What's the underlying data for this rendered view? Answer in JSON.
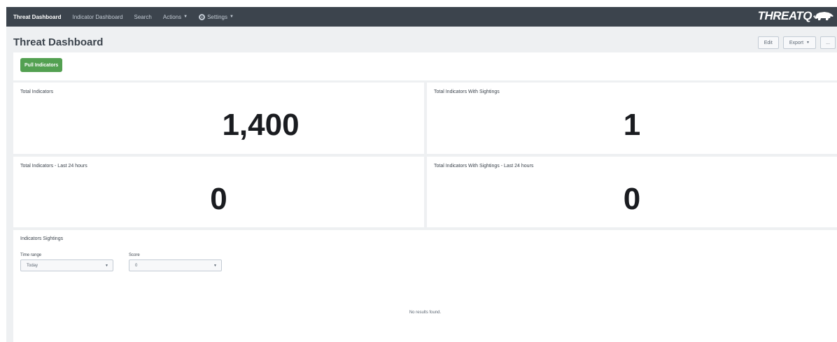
{
  "nav": {
    "items": [
      {
        "label": "Threat Dashboard",
        "active": true
      },
      {
        "label": "Indicator Dashboard",
        "active": false
      },
      {
        "label": "Search",
        "active": false
      },
      {
        "label": "Actions",
        "active": false
      },
      {
        "label": "Settings",
        "active": false
      }
    ],
    "logo": "THREATQ"
  },
  "page": {
    "title": "Threat Dashboard",
    "edit_label": "Edit",
    "export_label": "Export",
    "more_label": "..."
  },
  "toolbar": {
    "pull_label": "Pull Indicators"
  },
  "panels": [
    {
      "title": "Total Indicators",
      "value": "1,400"
    },
    {
      "title": "Total Indicators With Sightings",
      "value": "1"
    },
    {
      "title": "Total Indicators - Last 24 hours",
      "value": "0"
    },
    {
      "title": "Total Indicators With Sightings - Last 24 hours",
      "value": "0"
    }
  ],
  "sightings": {
    "title": "Indicators Sightings",
    "time_range_label": "Time range",
    "time_range_value": "Today",
    "score_label": "Score",
    "score_value": "0",
    "no_results": "No results found."
  },
  "colors": {
    "navbar": "#3c444d",
    "accent_green": "#53a051",
    "background": "#eef0f2"
  },
  "icons": [
    "caret-down-icon",
    "gear-icon",
    "rhino-logo-icon"
  ]
}
